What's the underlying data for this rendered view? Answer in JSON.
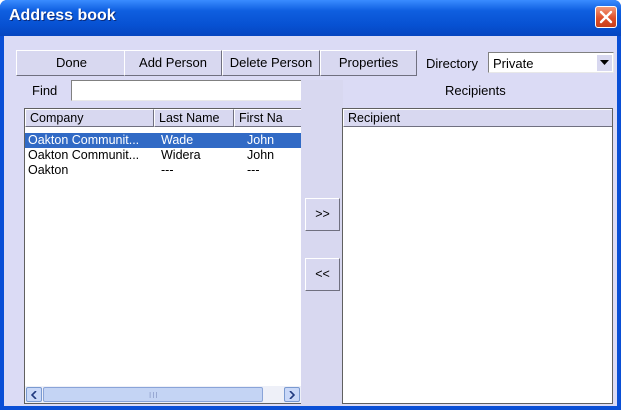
{
  "window": {
    "title": "Address book"
  },
  "toolbar": {
    "done_label": "Done",
    "add_person_label": "Add Person",
    "delete_person_label": "Delete Person",
    "properties_label": "Properties",
    "directory_label": "Directory",
    "directory_value": "Private"
  },
  "find": {
    "label": "Find",
    "value": ""
  },
  "recipients_label": "Recipients",
  "contacts": {
    "columns": [
      "Company",
      "Last Name",
      "First Na"
    ],
    "rows": [
      {
        "company": "Oakton Communit...",
        "last": "Wade",
        "first": "John",
        "selected": true
      },
      {
        "company": "Oakton Communit...",
        "last": "Widera",
        "first": "John",
        "selected": false
      },
      {
        "company": "Oakton",
        "last": "---",
        "first": "---",
        "selected": false
      }
    ]
  },
  "recipients_list": {
    "columns": [
      "Recipient"
    ],
    "rows": []
  },
  "move": {
    "add_label": ">>",
    "remove_label": "<<"
  },
  "scrollbar": {
    "grip": "III"
  },
  "colors": {
    "title_bar": "#0751d2",
    "client_bg": "#dbdbf5",
    "selection": "#316ac5",
    "close": "#e0502a"
  }
}
